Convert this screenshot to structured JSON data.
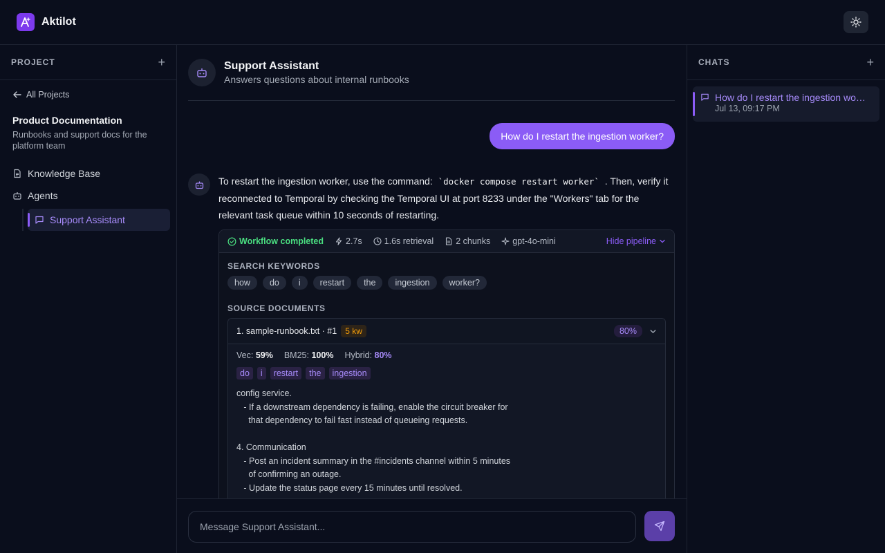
{
  "app": {
    "name": "Aktilot"
  },
  "left_panel": {
    "title": "PROJECT",
    "back_label": "All Projects",
    "project_name": "Product Documentation",
    "project_description": "Runbooks and support docs for the platform team",
    "nav": {
      "knowledge_base": "Knowledge Base",
      "agents": "Agents"
    },
    "active_agent": "Support Assistant"
  },
  "chat": {
    "agent_name": "Support Assistant",
    "agent_description": "Answers questions about internal runbooks",
    "user_message": "How do I restart the ingestion worker?",
    "assistant_message": {
      "before_code": "To restart the ingestion worker, use the command: ",
      "code": "`docker compose restart worker`",
      "after_code": ". Then, verify it reconnected to Temporal by checking the Temporal UI at port 8233 under the \"Workers\" tab for the relevant task queue within 10 seconds of restarting."
    },
    "pipeline": {
      "status": "Workflow completed",
      "duration": "2.7s",
      "retrieval": "1.6s retrieval",
      "chunks": "2 chunks",
      "model": "gpt-4o-mini",
      "toggle_label": "Hide pipeline",
      "keywords_title": "SEARCH KEYWORDS",
      "keywords": [
        "how",
        "do",
        "i",
        "restart",
        "the",
        "ingestion",
        "worker?"
      ],
      "sources_title": "SOURCE DOCUMENTS",
      "source": {
        "title": "1. sample-runbook.txt · #1",
        "keyword_count": "5 kw",
        "score": "80%",
        "vec_label": "Vec:",
        "vec": "59%",
        "bm25_label": "BM25:",
        "bm25": "100%",
        "hybrid_label": "Hybrid:",
        "hybrid": "80%",
        "matched": [
          "do",
          "i",
          "restart",
          "the",
          "ingestion"
        ],
        "excerpt": "config service.\n   - If a downstream dependency is failing, enable the circuit breaker for\n     that dependency to fail fast instead of queueing requests.\n\n4. Communication\n   - Post an incident summary in the #incidents channel within 5 minutes\n     of confirming an outage.\n   - Update the status page every 15 minutes until resolved."
      }
    },
    "composer": {
      "placeholder": "Message Support Assistant..."
    }
  },
  "right_panel": {
    "title": "CHATS",
    "chats": [
      {
        "title": "How do I restart the ingestion worker?",
        "time": "Jul 13, 09:17 PM"
      }
    ]
  },
  "colors": {
    "accent": "#8b5cf6",
    "success": "#4ade80",
    "warning": "#f59e0b",
    "background": "#0a0e1c"
  }
}
